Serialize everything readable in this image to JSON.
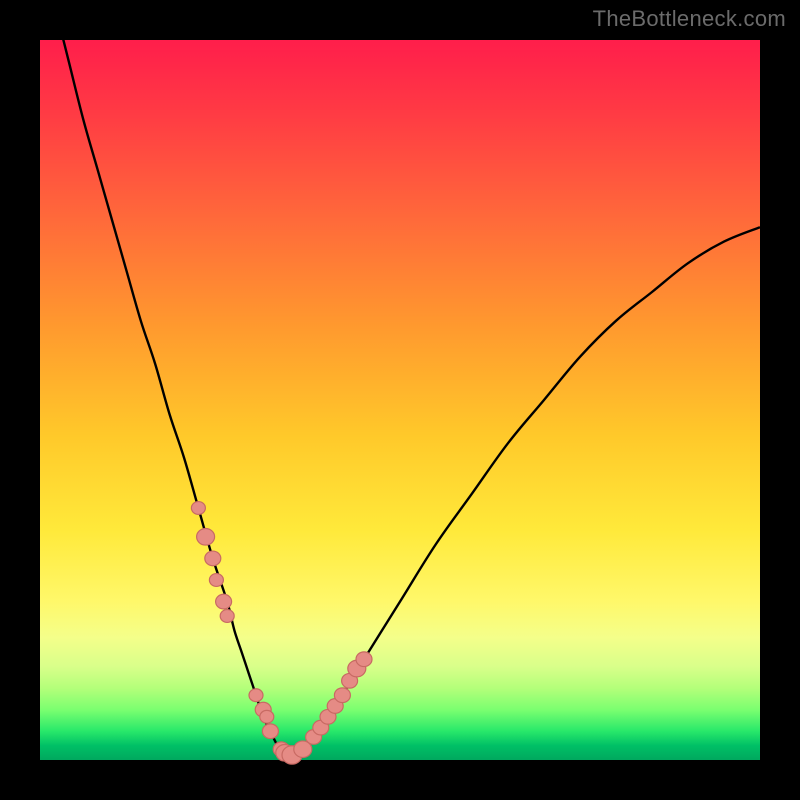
{
  "watermark": "TheBottleneck.com",
  "colors": {
    "frame_bg": "#000000",
    "curve_stroke": "#000000",
    "marker_fill": "#e58b85",
    "marker_stroke": "#c86a63",
    "gradient_top": "#ff1e4b",
    "gradient_bottom": "#00a85e"
  },
  "chart_data": {
    "type": "line",
    "title": "",
    "xlabel": "",
    "ylabel": "",
    "xlim": [
      0,
      100
    ],
    "ylim": [
      0,
      100
    ],
    "grid": false,
    "series": [
      {
        "name": "bottleneck-curve",
        "x": [
          2,
          4,
          6,
          8,
          10,
          12,
          14,
          16,
          18,
          20,
          22,
          24,
          26,
          27,
          28,
          29,
          30,
          31,
          32,
          33,
          34,
          35,
          36,
          37,
          38,
          40,
          42,
          45,
          50,
          55,
          60,
          65,
          70,
          75,
          80,
          85,
          90,
          95,
          100
        ],
        "y": [
          105,
          97,
          89,
          82,
          75,
          68,
          61,
          55,
          48,
          42,
          35,
          28,
          22,
          18,
          15,
          12,
          9,
          6,
          4,
          2,
          1,
          0.5,
          0.8,
          1.8,
          3.2,
          6,
          9,
          14,
          22,
          30,
          37,
          44,
          50,
          56,
          61,
          65,
          69,
          72,
          74
        ]
      }
    ],
    "markers": {
      "name": "highlighted-points",
      "x": [
        22,
        23,
        24,
        24.5,
        25.5,
        26,
        30,
        31,
        31.5,
        32,
        33.5,
        34,
        35,
        36.5,
        38,
        39,
        40,
        41,
        42,
        43,
        44,
        45
      ],
      "y": [
        35,
        31,
        28,
        25,
        22,
        20,
        9,
        7,
        6,
        4,
        1.5,
        1,
        0.7,
        1.5,
        3.2,
        4.5,
        6,
        7.5,
        9,
        11,
        12.7,
        14
      ],
      "r": [
        7,
        9,
        8,
        7,
        8,
        7,
        7,
        8,
        7,
        8,
        8,
        9,
        10,
        9,
        8,
        8,
        8,
        8,
        8,
        8,
        9,
        8
      ]
    }
  }
}
